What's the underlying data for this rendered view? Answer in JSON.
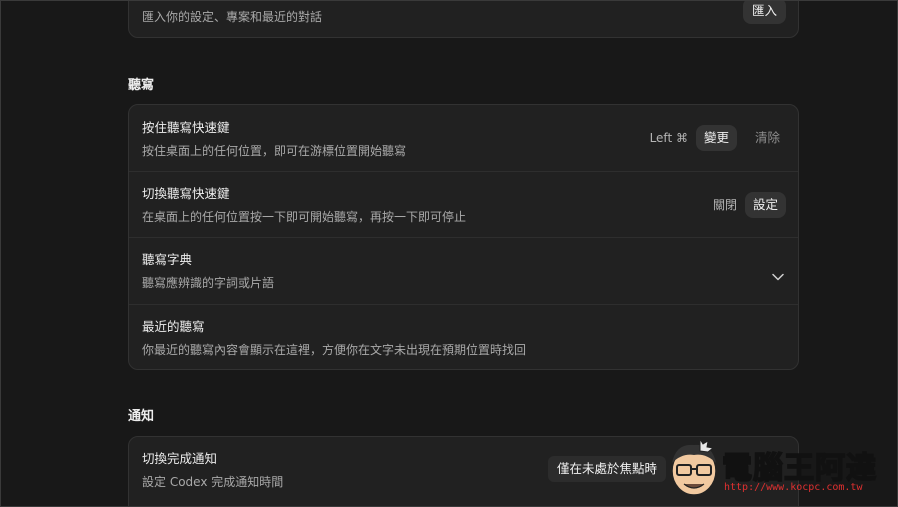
{
  "import_section": {
    "description": "匯入你的設定、專案和最近的對話",
    "import_button": "匯入"
  },
  "dictation_section": {
    "title": "聽寫",
    "rows": [
      {
        "title": "按住聽寫快速鍵",
        "description": "按住桌面上的任何位置，即可在游標位置開始聽寫",
        "shortcut": "Left ⌘",
        "change_button": "變更",
        "clear_button": "清除"
      },
      {
        "title": "切換聽寫快速鍵",
        "description": "在桌面上的任何位置按一下即可開始聽寫，再按一下即可停止",
        "status": "關閉",
        "set_button": "設定"
      },
      {
        "title": "聽寫字典",
        "description": "聽寫應辨識的字詞或片語",
        "icon": "chevron-down-icon"
      },
      {
        "title": "最近的聽寫",
        "description": "你最近的聽寫內容會顯示在這裡，方便你在文字未出現在預期位置時找回"
      }
    ]
  },
  "notification_section": {
    "title": "通知",
    "rows": [
      {
        "title": "切換完成通知",
        "description": "設定 Codex 完成通知時間",
        "selected_option": "僅在未處於焦點時"
      }
    ]
  },
  "watermark": {
    "name": "電腦王阿達",
    "url": "http://www.kocpc.com.tw"
  },
  "colors": {
    "background": "#181818",
    "panel": "#212121",
    "button": "#333333",
    "watermark_url": "#e03030"
  }
}
